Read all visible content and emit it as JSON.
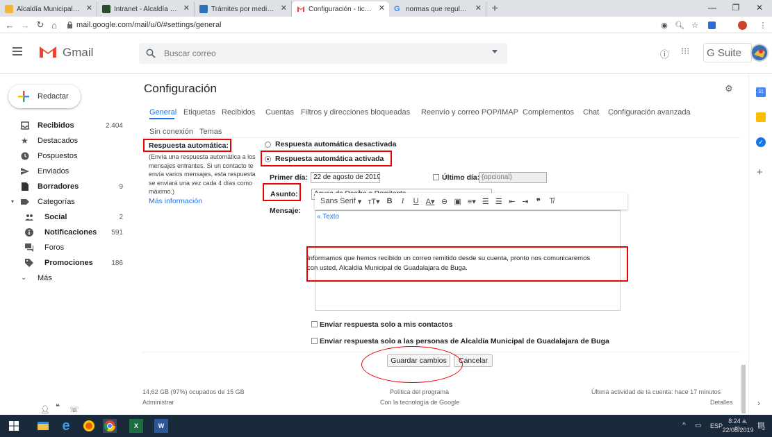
{
  "browser": {
    "tabs": [
      {
        "label": "Alcaldía Municipal de Guadalaj",
        "favicon_color": "#f2b53a"
      },
      {
        "label": "Intranet - Alcaldía de Buga - In",
        "favicon_color": "#2b4d2b"
      },
      {
        "label": "Trámites por medio electrónico",
        "favicon_color": "#2e6fb5"
      },
      {
        "label": "Configuración - tic@buga.gov",
        "favicon_color": "#ffffff"
      },
      {
        "label": "normas que regulan el acuse d",
        "favicon_color": "#ffffff"
      }
    ],
    "new_tab": "+",
    "url": "mail.google.com/mail/u/0/#settings/general"
  },
  "gmail": {
    "logo_text": "Gmail",
    "search_placeholder": "Buscar correo",
    "gsuite": "G Suite"
  },
  "sidebar": {
    "compose": "Redactar",
    "items": [
      {
        "label": "Recibidos",
        "count": "2.404"
      },
      {
        "label": "Destacados",
        "count": ""
      },
      {
        "label": "Pospuestos",
        "count": ""
      },
      {
        "label": "Enviados",
        "count": ""
      },
      {
        "label": "Borradores",
        "count": "9"
      },
      {
        "label": "Categorías",
        "count": ""
      },
      {
        "label": "Social",
        "count": "2"
      },
      {
        "label": "Notificaciones",
        "count": "591"
      },
      {
        "label": "Foros",
        "count": ""
      },
      {
        "label": "Promociones",
        "count": "186"
      },
      {
        "label": "Más",
        "count": ""
      }
    ]
  },
  "settings": {
    "title": "Configuración",
    "tabs": [
      "General",
      "Etiquetas",
      "Recibidos",
      "Cuentas",
      "Filtros y direcciones bloqueadas",
      "Reenvío y correo POP/IMAP",
      "Complementos",
      "Chat",
      "Configuración avanzada",
      "Sin conexión",
      "Temas"
    ],
    "auto_reply_label": "Respuesta automática:",
    "auto_reply_desc_1": "(Envía una respuesta automática a los",
    "auto_reply_desc_2": "mensajes entrantes. Si un contacto te",
    "auto_reply_desc_3": "envía varios mensajes, esta respuesta",
    "auto_reply_desc_4": "se enviará una vez cada 4 días como",
    "auto_reply_desc_5": "máximo.)",
    "more_info": "Más información",
    "radio_off": "Respuesta automática desactivada",
    "radio_on": "Respuesta automática activada",
    "first_day_label": "Primer día:",
    "first_day_value": "22 de agosto de 2019",
    "last_day_label": "Último día:",
    "last_day_placeholder": "(opcional)",
    "subject_label": "Asunto:",
    "subject_value": "Acuso de Recibo a Remitente",
    "message_label": "Mensaje:",
    "font_name": "Sans Serif",
    "text_link": "« Texto",
    "message_line_1": "Informamos que hemos recibido un correo  remitido desde su cuenta, pronto nos comunicaremos",
    "message_line_2": "con usted, Alcaldía Municipal de Guadalajara de Buga.",
    "only_contacts": "Enviar respuesta solo a mis contactos",
    "only_org": "Enviar respuesta solo a las personas de Alcaldía Municipal de Guadalajara de Buga",
    "save": "Guardar cambios",
    "cancel": "Cancelar"
  },
  "footer": {
    "storage": "14,62 GB (97%) ocupados de 15 GB",
    "manage": "Administrar",
    "policy": "Política del programa",
    "powered": "Con la tecnología de Google",
    "activity": "Última actividad de la cuenta: hace 17 minutos",
    "details": "Detalles"
  },
  "taskbar": {
    "lang": "ESP",
    "time": "8:24 a. m.",
    "date": "22/08/2019",
    "notifications": "2"
  },
  "colors": {
    "accent": "#1a73e8",
    "annotation": "#e00000",
    "gmail_red": "#ea4335"
  }
}
